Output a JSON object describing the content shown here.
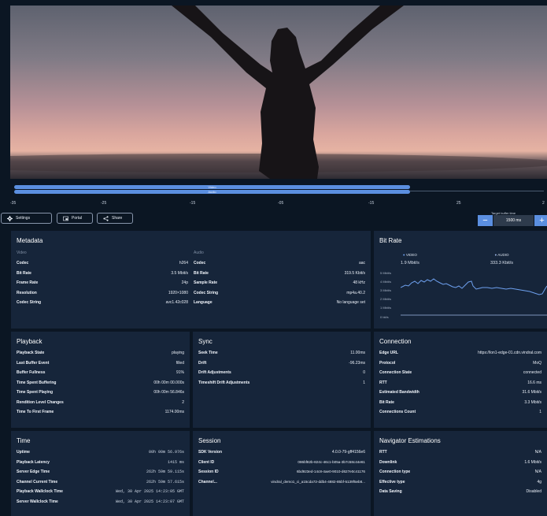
{
  "timeline": {
    "video_label": "Video",
    "audio_label": "Audio",
    "ticks": [
      "-35",
      "-25",
      "-15",
      "-05",
      "-15",
      "25",
      "2"
    ]
  },
  "controls": {
    "settings_label": "Settings",
    "portal_label": "Portal",
    "share_label": "Share",
    "target_label": "Target buffer time",
    "buffer_value": "1500 ms",
    "minus": "−",
    "plus": "+"
  },
  "metadata": {
    "title": "Metadata",
    "video": {
      "heading": "Video",
      "rows": [
        {
          "k": "Codec",
          "v": "h264"
        },
        {
          "k": "Bit Rate",
          "v": "3.5 Mbit/s"
        },
        {
          "k": "Frame Rate",
          "v": "24p"
        },
        {
          "k": "Resolution",
          "v": "1920×1080"
        },
        {
          "k": "Codec String",
          "v": "avc1.42c028"
        }
      ]
    },
    "audio": {
      "heading": "Audio",
      "rows": [
        {
          "k": "Codec",
          "v": "aac"
        },
        {
          "k": "Bit Rate",
          "v": "319.5 Kbit/s"
        },
        {
          "k": "Sample Rate",
          "v": "48 kHz"
        },
        {
          "k": "Codec String",
          "v": "mp4a.40.2"
        },
        {
          "k": "Language",
          "v": "No language set"
        }
      ]
    }
  },
  "bitrate": {
    "title": "Bit Rate",
    "video_legend": "VIDEO",
    "audio_legend": "AUDIO",
    "video_value": "1.9 Mbit/s",
    "audio_value": "333.3 Kbit/s",
    "y_labels": [
      "5 Mbit/s",
      "4 Mbit/s",
      "3 Mbit/s",
      "2 Mbit/s",
      "1 Mbit/s",
      "0 bit/s"
    ],
    "colors": {
      "video": "#6ea0ee",
      "audio": "#9fb8e6"
    }
  },
  "playback": {
    "title": "Playback",
    "rows": [
      {
        "k": "Playback State",
        "v": "playing"
      },
      {
        "k": "Last Buffer Event",
        "v": "filled"
      },
      {
        "k": "Buffer Fullness",
        "v": "91%"
      },
      {
        "k": "Time Spent Buffering",
        "v": "00h 00m 00.000s"
      },
      {
        "k": "Time Spent Playing",
        "v": "00h 00m 56.846s"
      },
      {
        "k": "Rendition Level Changes",
        "v": "2"
      },
      {
        "k": "Time To First Frame",
        "v": "1174.00ms"
      }
    ]
  },
  "sync": {
    "title": "Sync",
    "rows": [
      {
        "k": "Seek Time",
        "v": "11.00ms"
      },
      {
        "k": "Drift",
        "v": "-96.23ms"
      },
      {
        "k": "Drift Adjustments",
        "v": "0"
      },
      {
        "k": "Timeshift Drift Adjustments",
        "v": "1"
      }
    ]
  },
  "connection": {
    "title": "Connection",
    "rows": [
      {
        "k": "Edge URL",
        "v": "https://lon1-edge-01.cdn.vindral.com"
      },
      {
        "k": "Protocol",
        "v": "MoQ"
      },
      {
        "k": "Connection State",
        "v": "connected"
      },
      {
        "k": "RTT",
        "v": "16.6 ms"
      },
      {
        "k": "Estimated Bandwidth",
        "v": "31.6 Mbit/s"
      },
      {
        "k": "Bit Rate",
        "v": "3.3 Mbit/s"
      },
      {
        "k": "Connections Count",
        "v": "1"
      }
    ]
  },
  "time": {
    "title": "Time",
    "rows": [
      {
        "k": "Uptime",
        "v": "00h 00m 56.976s"
      },
      {
        "k": "Playback Latency",
        "v": "1415 ms"
      },
      {
        "k": "Server Edge Time",
        "v": "262h 59m 59.115s"
      },
      {
        "k": "Channel Current Time",
        "v": "262h 59m 57.615s"
      },
      {
        "k": "Playback Wallclock Time",
        "v": "Wed, 30 Apr 2025 14:23:05 GMT"
      },
      {
        "k": "Server Wallclock Time",
        "v": "Wed, 30 Apr 2025 14:23:07 GMT"
      }
    ]
  },
  "session": {
    "title": "Session",
    "rows": [
      {
        "k": "SDK Version",
        "v": "4.0.0-79-gff4156e6"
      },
      {
        "k": "Client ID",
        "v": "086bf82b-824c-46c1-b05a-3b7c58c44e61"
      },
      {
        "k": "Session ID",
        "v": "6bd923ed-14c8-4ae0-9010-d627e0c41176"
      },
      {
        "k": "Channel...",
        "v": "vindral_demo1_ci_a15cda72-ddb4-4882-85bf-5139f5eb8..."
      }
    ]
  },
  "navigator": {
    "title": "Navigator Estimations",
    "rows": [
      {
        "k": "RTT",
        "v": "N/A"
      },
      {
        "k": "Downlink",
        "v": "1.6 Mbit/s"
      },
      {
        "k": "Connection type",
        "v": "N/A"
      },
      {
        "k": "Effective type",
        "v": "4g"
      },
      {
        "k": "Data Saving",
        "v": "Disabled"
      }
    ]
  }
}
